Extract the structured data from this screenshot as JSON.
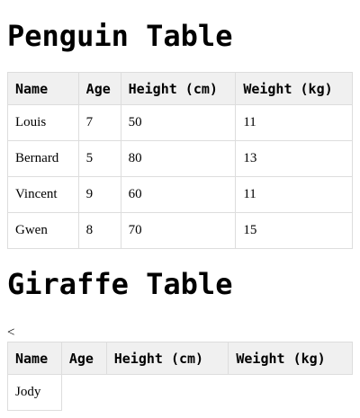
{
  "penguin": {
    "title": "Penguin Table",
    "headers": [
      "Name",
      "Age",
      "Height (cm)",
      "Weight (kg)"
    ],
    "rows": [
      [
        "Louis",
        "7",
        "50",
        "11"
      ],
      [
        "Bernard",
        "5",
        "80",
        "13"
      ],
      [
        "Vincent",
        "9",
        "60",
        "11"
      ],
      [
        "Gwen",
        "8",
        "70",
        "15"
      ]
    ]
  },
  "stray_text": "<",
  "giraffe": {
    "title": "Giraffe Table",
    "headers": [
      "Name",
      "Age",
      "Height (cm)",
      "Weight (kg)"
    ],
    "rows": [
      [
        "Jody"
      ]
    ]
  }
}
